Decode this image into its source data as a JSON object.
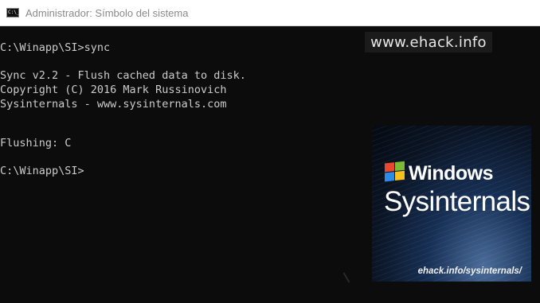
{
  "window": {
    "title": "Administrador: Símbolo del sistema",
    "icon": "cmd-icon"
  },
  "console": {
    "lines": [
      "C:\\Winapp\\SI>sync",
      "Sync v2.2 - Flush cached data to disk.",
      "Copyright (C) 2016 Mark Russinovich",
      "Sysinternals - www.sysinternals.com",
      "Flushing: C",
      "C:\\Winapp\\SI>"
    ]
  },
  "watermark": {
    "top_text": "www.ehack.info"
  },
  "logo": {
    "windows_text": "Windows",
    "sysinternals_text": "Sysinternals",
    "url_text": "ehack.info/sysinternals/",
    "flag_colors": [
      "#e8482c",
      "#7cbb34",
      "#2d8be8",
      "#f8c01f"
    ]
  }
}
